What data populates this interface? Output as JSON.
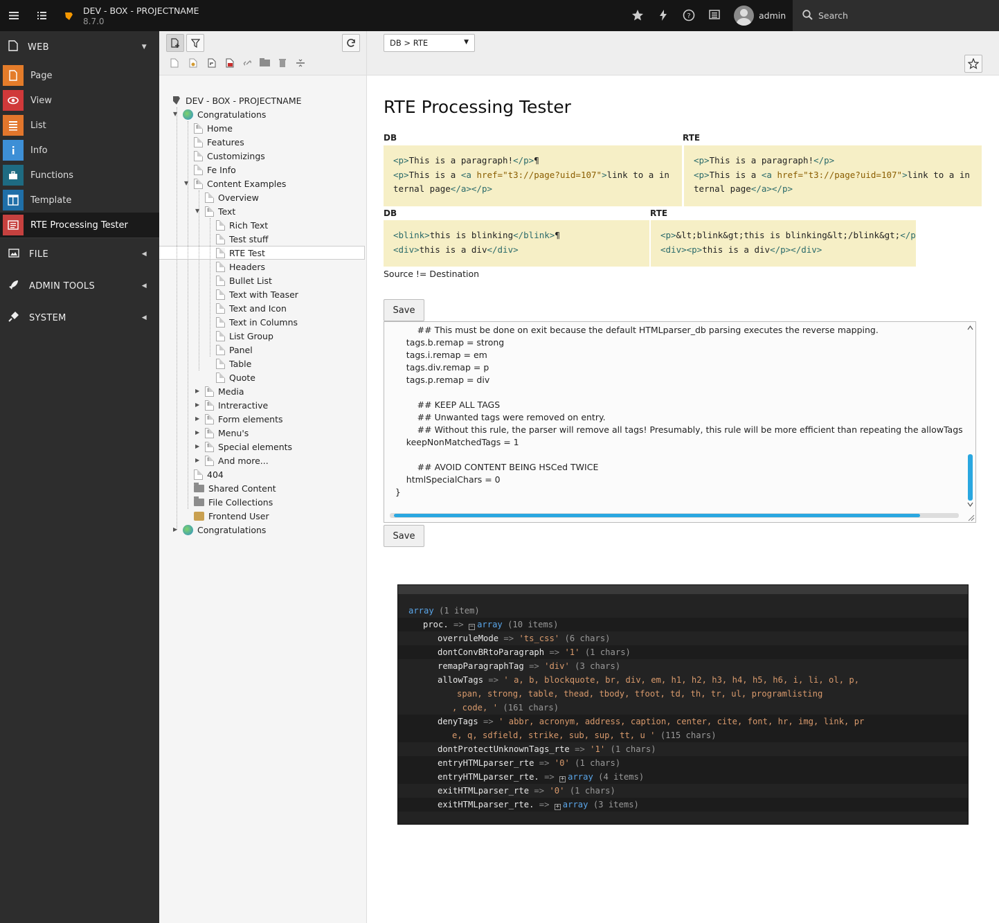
{
  "topbar": {
    "site_name": "DEV - BOX - PROJECTNAME",
    "version": "8.7.0",
    "user": "admin",
    "search_placeholder": "Search"
  },
  "sidebar": {
    "groups": {
      "web": "WEB",
      "file": "FILE",
      "admin_tools": "ADMIN TOOLS",
      "system": "SYSTEM"
    },
    "modules": [
      {
        "label": "Page",
        "color": "#e47c2a",
        "icon": "page-icon"
      },
      {
        "label": "View",
        "color": "#d0393a",
        "icon": "eye-icon"
      },
      {
        "label": "List",
        "color": "#e2762c",
        "icon": "list-icon"
      },
      {
        "label": "Info",
        "color": "#3d8fd6",
        "icon": "info-icon"
      },
      {
        "label": "Functions",
        "color": "#1e6b82",
        "icon": "functions-icon"
      },
      {
        "label": "Template",
        "color": "#1f6fa8",
        "icon": "template-icon"
      },
      {
        "label": "RTE Processing Tester",
        "color": "#c6413f",
        "icon": "rte-icon"
      }
    ]
  },
  "tree": {
    "root": "DEV - BOX - PROJECTNAME",
    "nodes": [
      "Congratulations",
      "Home",
      "Features",
      "Customizings",
      "Fe Info",
      "Content Examples",
      "Overview",
      "Text",
      "Rich Text",
      "Test stuff",
      "RTE Test",
      "Headers",
      "Bullet List",
      "Text with Teaser",
      "Text and Icon",
      "Text in Columns",
      "List Group",
      "Panel",
      "Table",
      "Quote",
      "Media",
      "Intreractive",
      "Form elements",
      "Menu's",
      "Special elements",
      "And more...",
      "404",
      "Shared Content",
      "File Collections",
      "Frontend User",
      "Congratulations"
    ]
  },
  "docheader": {
    "selector": "DB > RTE"
  },
  "main": {
    "title": "RTE Processing Tester",
    "db_label": "DB",
    "rte_label": "RTE",
    "source_note": "Source != Destination",
    "save_label": "Save",
    "textarea_lines": [
      "            ## This must be done on exit because the default HTMLparser_db parsing executes the reverse mapping.",
      "        tags.b.remap = strong",
      "        tags.i.remap = em",
      "        tags.div.remap = p",
      "        tags.p.remap = div",
      "",
      "            ## KEEP ALL TAGS",
      "            ## Unwanted tags were removed on entry.",
      "            ## Without this rule, the parser will remove all tags! Presumably, this rule will be more efficient than repeating the allowTags",
      "        keepNonMatchedTags = 1",
      "",
      "            ## AVOID CONTENT BEING HSCed TWICE",
      "        htmlSpecialChars = 0",
      "    }"
    ]
  },
  "debug": {
    "root_type": "array",
    "root_count": "(1 item)",
    "proc_key": "proc.",
    "proc_count": "(10 items)",
    "rows": [
      {
        "key": "overruleMode",
        "val": "'ts_css'",
        "meta": "(6 chars)"
      },
      {
        "key": "dontConvBRtoParagraph",
        "val": "'1'",
        "meta": "(1 chars)"
      },
      {
        "key": "remapParagraphTag",
        "val": "'div'",
        "meta": "(3 chars)"
      }
    ],
    "allowTags_key": "allowTags",
    "allowTags_l1": "' a, b, blockquote, br, div, em, h1, h2, h3, h4, h5, h6, i, li, ol, p,",
    "allowTags_l2": "span, strong, table, thead, tbody, tfoot, td, th, tr, ul, programlisting",
    "allowTags_l3": ", code, '",
    "allowTags_meta": "(161 chars)",
    "denyTags_key": "denyTags",
    "denyTags_l1": "' abbr, acronym, address, caption, center, cite, font, hr, img, link, pr",
    "denyTags_l2": "e, q, sdfield, strike, sub, sup, tt, u '",
    "denyTags_meta": "(115 chars)",
    "rows2": [
      {
        "key": "dontProtectUnknownTags_rte",
        "val": "'1'",
        "meta": "(1 chars)"
      },
      {
        "key": "entryHTMLparser_rte",
        "val": "'0'",
        "meta": "(1 chars)"
      }
    ],
    "entryArr_key": "entryHTMLparser_rte.",
    "entryArr_count": "(4 items)",
    "exitHTML_key": "exitHTMLparser_rte",
    "exitHTML_val": "'0'",
    "exitHTML_meta": "(1 chars)",
    "exitArr_key": "exitHTMLparser_rte.",
    "exitArr_count": "(3 items)"
  }
}
